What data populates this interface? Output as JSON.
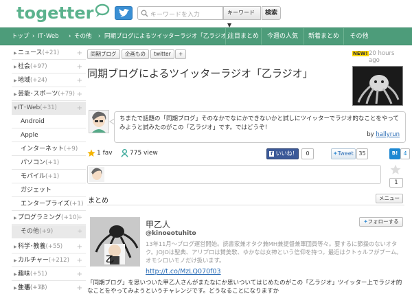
{
  "header": {
    "logo_text": "togetter",
    "search_placeholder": "キーワードを入力",
    "search_mode": "キーワード",
    "search_button": "検索"
  },
  "navbar": {
    "breadcrumb": [
      "トップ",
      "IT･Web",
      "その他",
      "同期ブログによるツイッターラジオ「乙ラジオ」"
    ],
    "links": [
      "注目まとめ",
      "今週の人気",
      "新着まとめ",
      "その他"
    ]
  },
  "sidebar": {
    "items": [
      {
        "label": "ニュース",
        "count": "(+21)"
      },
      {
        "label": "社会",
        "count": "(+97)"
      },
      {
        "label": "地域",
        "count": "(+24)"
      },
      {
        "label": "芸能･スポーツ",
        "count": "(+79)"
      },
      {
        "label": "IT･Web",
        "count": "(+31)"
      }
    ],
    "subitems": [
      {
        "label": "Android",
        "count": ""
      },
      {
        "label": "Apple",
        "count": ""
      },
      {
        "label": "インターネット",
        "count": "(+9)"
      },
      {
        "label": "パソコン",
        "count": "(+1)"
      },
      {
        "label": "モバイル",
        "count": "(+1)"
      },
      {
        "label": "ガジェット",
        "count": ""
      },
      {
        "label": "エンタープライズ",
        "count": "(+1)"
      },
      {
        "label": "プログラミング",
        "count": "(+10)"
      },
      {
        "label": "その他",
        "count": "(+9)"
      }
    ],
    "after": [
      {
        "label": "科学･教養",
        "count": "(+55)"
      },
      {
        "label": "カルチャー",
        "count": "(+212)"
      },
      {
        "label": "趣味",
        "count": "(+51)"
      },
      {
        "label": "生活",
        "count": "(+38)"
      },
      {
        "label": "仕事",
        "count": "(+7)"
      }
    ]
  },
  "main": {
    "tags": [
      "同期ブログ",
      "企画もの",
      "twitter",
      "+"
    ],
    "new_badge": "NEW!",
    "time_ago": "20 hours ago",
    "title": "同期ブログによるツイッターラジオ「乙ラジオ」",
    "description": "ちまたで話題の「同期ブログ」そのなかでなにかできないかと試しにツイッターでラジオ的なことをやってみようと試みたのがこの「乙ラジオ」です。ではどうぞ！",
    "by_label": "by",
    "author": "hallyrun",
    "fav_count": "1 fav",
    "view_count": "775 view",
    "fb_label": "いいね！",
    "fb_count": "0",
    "tweet_label": "Tweet",
    "tweet_count": "35",
    "hatebu_count": "4",
    "star_count": "1",
    "section_title": "まとめ",
    "menu_button": "メニュー",
    "tweet": {
      "name": "甲乙人",
      "handle": "@kinoeotuhito",
      "follow": "フォローする",
      "bio": "13年11月～ブログ運営開始。読書家兼オタク兼MH兼提督兼軍団員等々。要するに節操のないオタク。JOJOは聖典、アリプロは賛美歌、ゆかなは女神という信仰を持つ。最近はクトゥルフがブーム。オモシロいモノだけ扱います。",
      "link": "http://t.co/MzLQ070f03"
    },
    "body_text": "「同期ブログ」を思いついた甲乙人さんがまたなにか思いついてはじめたのがこの「乙ラジオ」ツイッター上でラジオ的なことをやってみようというチャレンジです。どうなることになりますか"
  },
  "colors": {
    "nav_bg": "#4d9c7a",
    "logo_green": "#5bb28d",
    "twitter_blue": "#3a8fd4",
    "fb_blue": "#3b5998"
  }
}
